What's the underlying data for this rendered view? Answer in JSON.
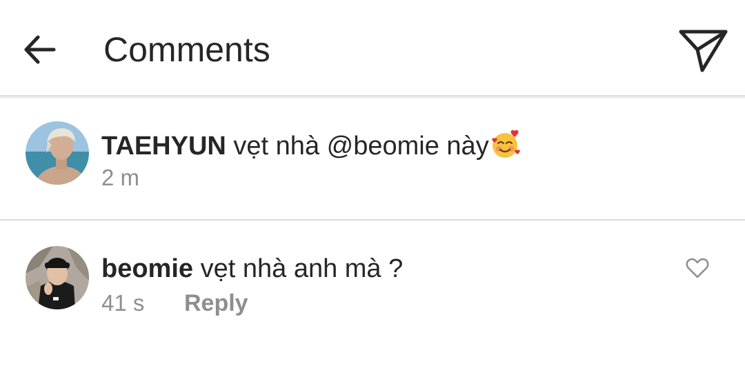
{
  "header": {
    "title": "Comments",
    "back_icon": "arrow-left-icon",
    "share_icon": "paper-plane-icon"
  },
  "caption": {
    "username": "TAEHYUN",
    "text": "vẹt nhà",
    "mention": "@beomie",
    "text_after": "này",
    "emoji": "smiling-face-with-hearts",
    "time": "2 m"
  },
  "comment": {
    "username": "beomie",
    "text": "vẹt nhà anh mà ?",
    "time": "41 s",
    "reply_label": "Reply",
    "like_icon": "heart-outline-icon"
  },
  "colors": {
    "text": "#262626",
    "secondary": "#8e8e8e",
    "divider": "#dbdbdb"
  }
}
